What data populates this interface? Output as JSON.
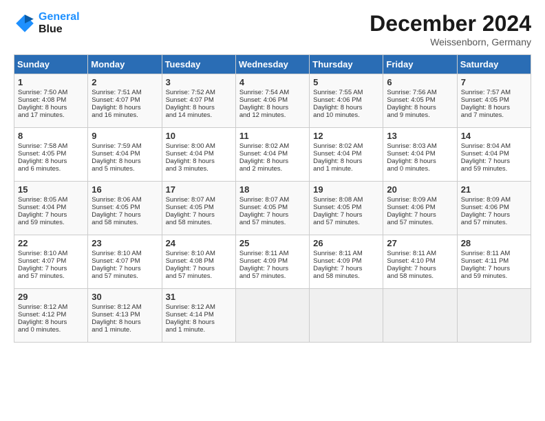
{
  "header": {
    "logo_line1": "General",
    "logo_line2": "Blue",
    "month": "December 2024",
    "location": "Weissenborn, Germany"
  },
  "days_of_week": [
    "Sunday",
    "Monday",
    "Tuesday",
    "Wednesday",
    "Thursday",
    "Friday",
    "Saturday"
  ],
  "weeks": [
    [
      {
        "day": "1",
        "info": "Sunrise: 7:50 AM\nSunset: 4:08 PM\nDaylight: 8 hours\nand 17 minutes."
      },
      {
        "day": "2",
        "info": "Sunrise: 7:51 AM\nSunset: 4:07 PM\nDaylight: 8 hours\nand 16 minutes."
      },
      {
        "day": "3",
        "info": "Sunrise: 7:52 AM\nSunset: 4:07 PM\nDaylight: 8 hours\nand 14 minutes."
      },
      {
        "day": "4",
        "info": "Sunrise: 7:54 AM\nSunset: 4:06 PM\nDaylight: 8 hours\nand 12 minutes."
      },
      {
        "day": "5",
        "info": "Sunrise: 7:55 AM\nSunset: 4:06 PM\nDaylight: 8 hours\nand 10 minutes."
      },
      {
        "day": "6",
        "info": "Sunrise: 7:56 AM\nSunset: 4:05 PM\nDaylight: 8 hours\nand 9 minutes."
      },
      {
        "day": "7",
        "info": "Sunrise: 7:57 AM\nSunset: 4:05 PM\nDaylight: 8 hours\nand 7 minutes."
      }
    ],
    [
      {
        "day": "8",
        "info": "Sunrise: 7:58 AM\nSunset: 4:05 PM\nDaylight: 8 hours\nand 6 minutes."
      },
      {
        "day": "9",
        "info": "Sunrise: 7:59 AM\nSunset: 4:04 PM\nDaylight: 8 hours\nand 5 minutes."
      },
      {
        "day": "10",
        "info": "Sunrise: 8:00 AM\nSunset: 4:04 PM\nDaylight: 8 hours\nand 3 minutes."
      },
      {
        "day": "11",
        "info": "Sunrise: 8:02 AM\nSunset: 4:04 PM\nDaylight: 8 hours\nand 2 minutes."
      },
      {
        "day": "12",
        "info": "Sunrise: 8:02 AM\nSunset: 4:04 PM\nDaylight: 8 hours\nand 1 minute."
      },
      {
        "day": "13",
        "info": "Sunrise: 8:03 AM\nSunset: 4:04 PM\nDaylight: 8 hours\nand 0 minutes."
      },
      {
        "day": "14",
        "info": "Sunrise: 8:04 AM\nSunset: 4:04 PM\nDaylight: 7 hours\nand 59 minutes."
      }
    ],
    [
      {
        "day": "15",
        "info": "Sunrise: 8:05 AM\nSunset: 4:04 PM\nDaylight: 7 hours\nand 59 minutes."
      },
      {
        "day": "16",
        "info": "Sunrise: 8:06 AM\nSunset: 4:05 PM\nDaylight: 7 hours\nand 58 minutes."
      },
      {
        "day": "17",
        "info": "Sunrise: 8:07 AM\nSunset: 4:05 PM\nDaylight: 7 hours\nand 58 minutes."
      },
      {
        "day": "18",
        "info": "Sunrise: 8:07 AM\nSunset: 4:05 PM\nDaylight: 7 hours\nand 57 minutes."
      },
      {
        "day": "19",
        "info": "Sunrise: 8:08 AM\nSunset: 4:05 PM\nDaylight: 7 hours\nand 57 minutes."
      },
      {
        "day": "20",
        "info": "Sunrise: 8:09 AM\nSunset: 4:06 PM\nDaylight: 7 hours\nand 57 minutes."
      },
      {
        "day": "21",
        "info": "Sunrise: 8:09 AM\nSunset: 4:06 PM\nDaylight: 7 hours\nand 57 minutes."
      }
    ],
    [
      {
        "day": "22",
        "info": "Sunrise: 8:10 AM\nSunset: 4:07 PM\nDaylight: 7 hours\nand 57 minutes."
      },
      {
        "day": "23",
        "info": "Sunrise: 8:10 AM\nSunset: 4:07 PM\nDaylight: 7 hours\nand 57 minutes."
      },
      {
        "day": "24",
        "info": "Sunrise: 8:10 AM\nSunset: 4:08 PM\nDaylight: 7 hours\nand 57 minutes."
      },
      {
        "day": "25",
        "info": "Sunrise: 8:11 AM\nSunset: 4:09 PM\nDaylight: 7 hours\nand 57 minutes."
      },
      {
        "day": "26",
        "info": "Sunrise: 8:11 AM\nSunset: 4:09 PM\nDaylight: 7 hours\nand 58 minutes."
      },
      {
        "day": "27",
        "info": "Sunrise: 8:11 AM\nSunset: 4:10 PM\nDaylight: 7 hours\nand 58 minutes."
      },
      {
        "day": "28",
        "info": "Sunrise: 8:11 AM\nSunset: 4:11 PM\nDaylight: 7 hours\nand 59 minutes."
      }
    ],
    [
      {
        "day": "29",
        "info": "Sunrise: 8:12 AM\nSunset: 4:12 PM\nDaylight: 8 hours\nand 0 minutes."
      },
      {
        "day": "30",
        "info": "Sunrise: 8:12 AM\nSunset: 4:13 PM\nDaylight: 8 hours\nand 1 minute."
      },
      {
        "day": "31",
        "info": "Sunrise: 8:12 AM\nSunset: 4:14 PM\nDaylight: 8 hours\nand 1 minute."
      },
      {
        "day": "",
        "info": ""
      },
      {
        "day": "",
        "info": ""
      },
      {
        "day": "",
        "info": ""
      },
      {
        "day": "",
        "info": ""
      }
    ]
  ]
}
